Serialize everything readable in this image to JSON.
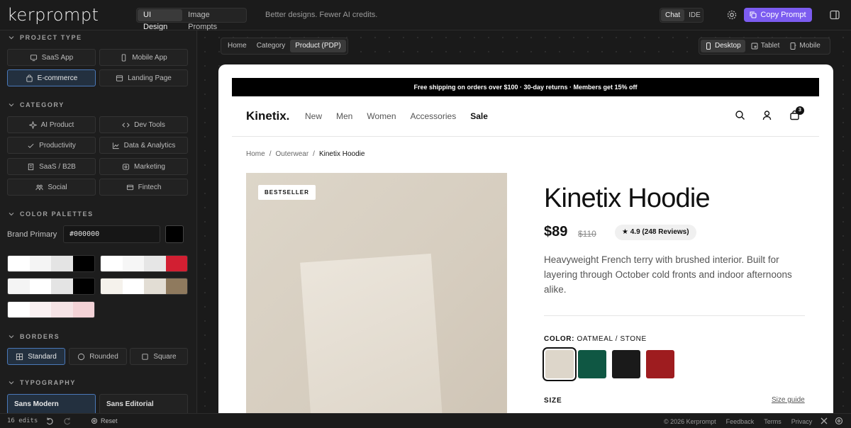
{
  "app": {
    "logo": "kerprompt",
    "modes": [
      "UI Design",
      "Image Prompts"
    ],
    "tagline": "Better designs. Fewer AI credits.",
    "chat_modes": [
      "Chat",
      "IDE"
    ],
    "copy_label": "Copy Prompt"
  },
  "sidebar": {
    "project_type": {
      "title": "PROJECT TYPE",
      "options": [
        "SaaS App",
        "Mobile App",
        "E-commerce",
        "Landing Page"
      ],
      "selected": "E-commerce"
    },
    "category": {
      "title": "CATEGORY",
      "options": [
        "AI Product",
        "Dev Tools",
        "Productivity",
        "Data & Analytics",
        "SaaS / B2B",
        "Marketing",
        "Social",
        "Fintech"
      ]
    },
    "palettes": {
      "title": "COLOR PALETTES",
      "brand_label": "Brand Primary",
      "brand_value": "#000000",
      "brand_color": "#000000",
      "sets": [
        [
          "#ffffff",
          "#f4f4f4",
          "#e4e4e4",
          "#000000"
        ],
        [
          "#ffffff",
          "#f6f6f6",
          "#e6e6e6",
          "#d21f32"
        ],
        [
          "#f4f4f4",
          "#ffffff",
          "#e4e4e4",
          "#000000"
        ],
        [
          "#f5f2ec",
          "#ffffff",
          "#e2ddd4",
          "#8f7a5e"
        ],
        [
          "#ffffff",
          "#faf1f2",
          "#f5e3e5",
          "#f3d2d6"
        ]
      ]
    },
    "borders": {
      "title": "BORDERS",
      "options": [
        "Standard",
        "Rounded",
        "Square"
      ],
      "selected": "Standard"
    },
    "typography": {
      "title": "TYPOGRAPHY",
      "options": [
        "Sans Modern",
        "Sans Editorial"
      ],
      "selected": "Sans Modern"
    }
  },
  "footer": {
    "edits": "16 edits",
    "reset": "Reset",
    "copyright": "© 2026 Kerprompt",
    "links": [
      "Feedback",
      "Terms",
      "Privacy"
    ]
  },
  "canvas": {
    "page_tabs": [
      "Home",
      "Category",
      "Product (PDP)"
    ],
    "page_selected": "Product (PDP)",
    "devices": [
      "Desktop",
      "Tablet",
      "Mobile"
    ],
    "device_selected": "Desktop"
  },
  "store": {
    "promo": "Free shipping on orders over $100 · 30-day returns · Members get 15% off",
    "logo": "Kinetix.",
    "nav": [
      "New",
      "Men",
      "Women",
      "Accessories",
      "Sale"
    ],
    "cart_count": "3",
    "breadcrumb": [
      "Home",
      "Outerwear",
      "Kinetix Hoodie"
    ],
    "badge": "BESTSELLER",
    "product": {
      "title": "Kinetix Hoodie",
      "price": "$89",
      "old_price": "$110",
      "rating": "★ 4.9 (248 Reviews)",
      "description": "Heavyweight French terry with brushed interior. Built for layering through October cold fronts and indoor afternoons alike.",
      "color_label": "COLOR:",
      "color_value": "OATMEAL / STONE",
      "swatches": [
        "#ddd6ca",
        "#0f5743",
        "#1a1a1a",
        "#9e1c1f"
      ],
      "size_label": "SIZE",
      "size_guide": "Size guide"
    }
  }
}
